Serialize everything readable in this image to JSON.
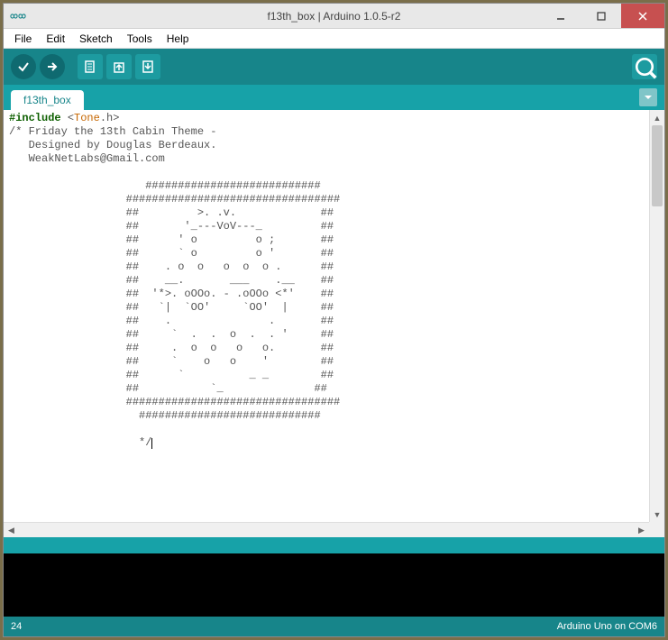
{
  "window": {
    "title": "f13th_box | Arduino 1.0.5-r2"
  },
  "menu": {
    "file": "File",
    "edit": "Edit",
    "sketch": "Sketch",
    "tools": "Tools",
    "help": "Help"
  },
  "tabs": {
    "active": "f13th_box"
  },
  "editor": {
    "include_keyword": "#include ",
    "include_lib": "Tone",
    "include_ext": ".h",
    "code_lines": [
      "/* Friday the 13th Cabin Theme -",
      "   Designed by Douglas Berdeaux.",
      "   WeakNetLabs@Gmail.com",
      "",
      "                     ###########################",
      "                  #################################",
      "                  ##         >. .v.             ##",
      "                  ##       '_---VoV---_         ##",
      "                  ##      ' o         o ;       ##",
      "                  ##      ` o         o '       ##",
      "                  ##    . o  o   o  o  o .      ##",
      "                  ##    __.       ___    .__    ##",
      "                  ##  '*>. oOOo. - .oOOo <*'    ##",
      "                  ##   `|  `OO'     `OO'  |     ##",
      "                  ##    .               .       ##",
      "                  ##     `  .  .  o  .  . '     ##",
      "                  ##     .  o  o   o   o.       ##",
      "                  ##     `    o   o    '        ##",
      "                  ##      `          _ _        ##",
      "                  ##           `_              ##",
      "                  #################################",
      "                    ############################",
      "",
      "                    */"
    ]
  },
  "status": {
    "line_number": "24",
    "board_port": "Arduino Uno on COM6"
  },
  "icons": {
    "verify": "verify-icon",
    "upload": "upload-icon",
    "new": "new-icon",
    "open": "open-icon",
    "save": "save-icon",
    "serial": "serial-monitor-icon"
  }
}
